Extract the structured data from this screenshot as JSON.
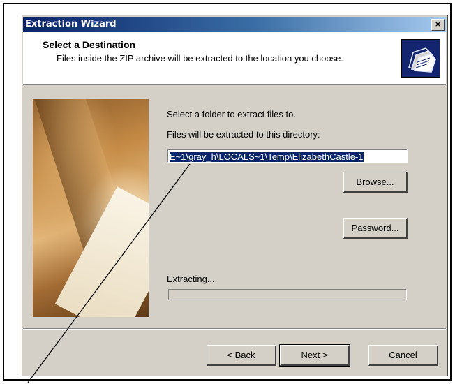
{
  "window": {
    "title": "Extraction Wizard",
    "close_glyph": "×"
  },
  "header": {
    "title": "Select a Destination",
    "subtitle": "Files inside the ZIP archive will be extracted to the location you choose.",
    "icon": "folders-icon"
  },
  "body": {
    "instruction": "Select a folder to extract files to.",
    "dir_label": "Files will be extracted to this directory:",
    "path_value": "E~1\\gray_h\\LOCALS~1\\Temp\\ElizabethCastle-1",
    "browse_label": "Browse...",
    "password_label": "Password...",
    "progress_label": "Extracting...",
    "progress_fraction": 0
  },
  "footer": {
    "back_label": "< Back",
    "next_label": "Next >",
    "cancel_label": "Cancel"
  },
  "colors": {
    "titlebar": "#0a246a",
    "face": "#d4d0c8",
    "selection": "#0a246a"
  }
}
